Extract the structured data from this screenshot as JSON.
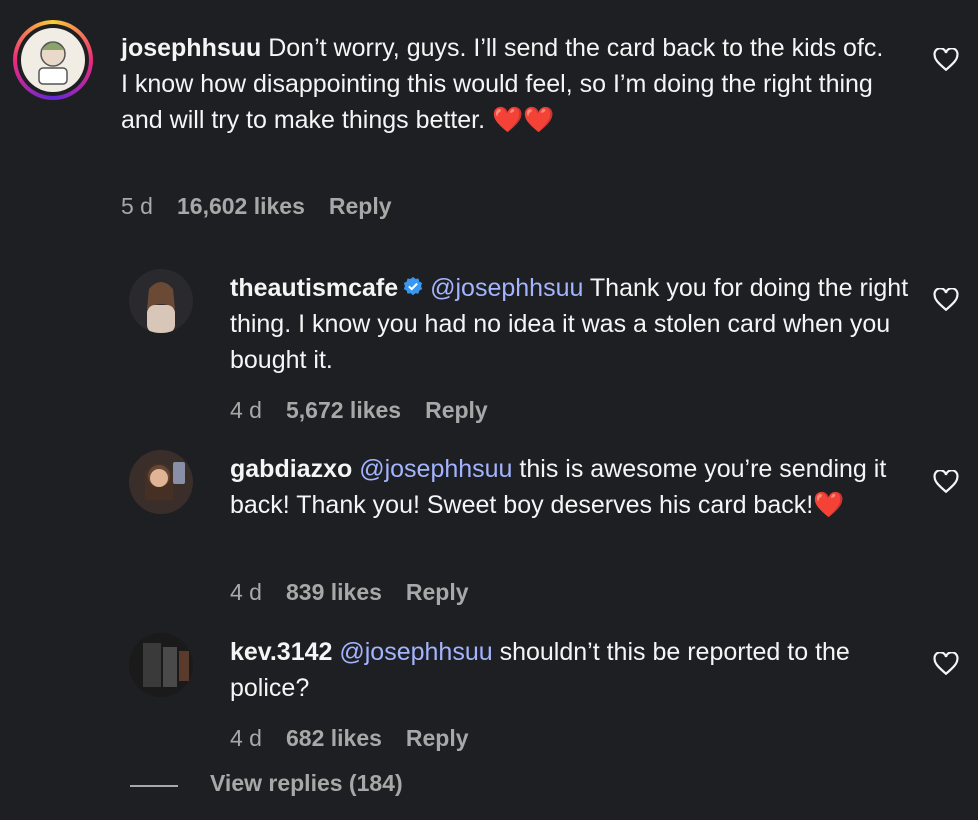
{
  "comments": [
    {
      "username": "josephhsuu",
      "text": "Don’t worry, guys. I’ll send the card back to the kids ofc.",
      "text2": "I know how disappointing this would feel, so I’m doing the right thing and will try to make things better.",
      "emoji": "❤️❤️",
      "time": "5 d",
      "likes": "16,602 likes",
      "reply": "Reply"
    },
    {
      "username": "theautismcafe",
      "mention": "@josephhsuu",
      "text": "Thank you for doing the right thing. I know you had no idea it was a stolen card when you bought it.",
      "time": "4 d",
      "likes": "5,672 likes",
      "reply": "Reply"
    },
    {
      "username": "gabdiazxo",
      "mention": "@josephhsuu",
      "text": "this is awesome you’re sending it back! Thank you! Sweet boy deserves his card back!",
      "emoji": "❤️",
      "time": "4 d",
      "likes": "839 likes",
      "reply": "Reply"
    },
    {
      "username": "kev.3142",
      "mention": "@josephhsuu",
      "text": "shouldn’t this be reported to the police?",
      "time": "4 d",
      "likes": "682 likes",
      "reply": "Reply"
    }
  ],
  "view_replies": "View replies (184)",
  "colors": {
    "background": "#1e1f22",
    "mention": "#a3b4ff",
    "muted": "#a8a8a8",
    "verified": "#3897f0"
  }
}
